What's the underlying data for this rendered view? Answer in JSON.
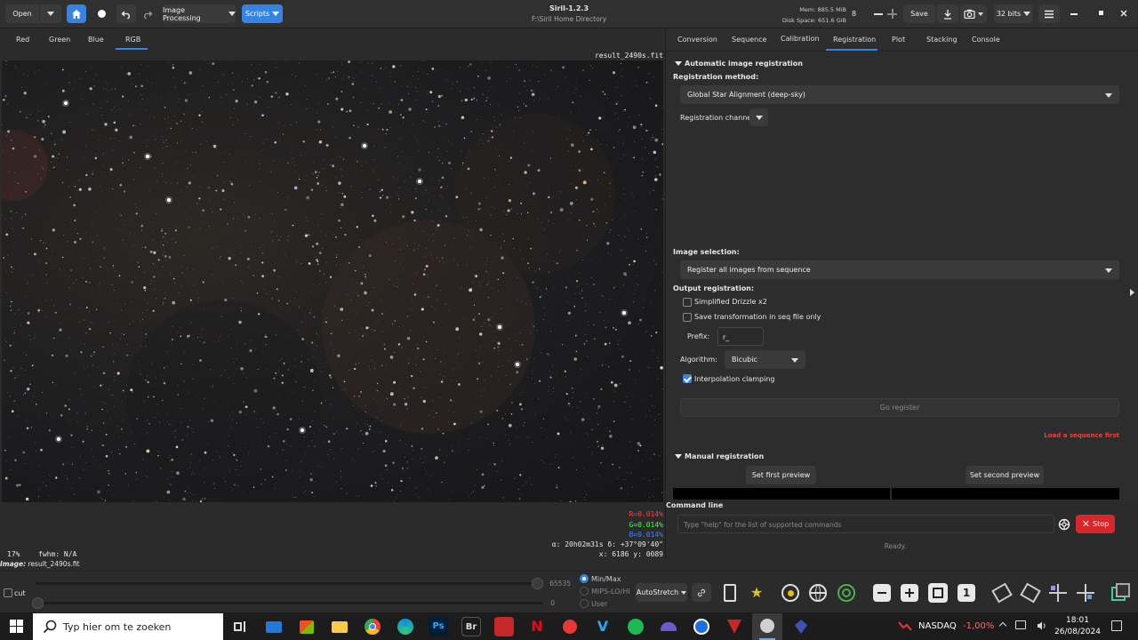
{
  "header": {
    "open_label": "Open",
    "image_processing_label": "Image Processing",
    "scripts_label": "Scripts",
    "app_title": "Siril-1.2.3",
    "app_subtitle": "F:\\Siril Home Directory",
    "mem": "Mem: 885.5 MiB",
    "disk": "Disk Space: 651.6 GiB",
    "threads": "8",
    "save_label": "Save",
    "bits_label": "32 bits"
  },
  "channels": [
    "Red",
    "Green",
    "Blue",
    "RGB"
  ],
  "viewer": {
    "filename": "result_2490s.fit",
    "r_value": "R=0.014%",
    "g_value": "G=0.014%",
    "b_value": "B=0.014%",
    "zoom": "17%",
    "fwhm": "fwhm: N/A",
    "coords": "α: 20h02m31s δ: +37°09'40\"",
    "xy": "x: 6186 y: 0089",
    "image_label": "Image:",
    "image_name": "result_2490s.fit"
  },
  "tabs": [
    "Conversion",
    "Sequence",
    "Calibration",
    "Registration",
    "Plot",
    "Stacking",
    "Console"
  ],
  "registration": {
    "section_title": "Automatic image registration",
    "method_label": "Registration method:",
    "method_value": "Global Star Alignment (deep-sky)",
    "channel_label": "Registration channel:",
    "selection_label": "Image selection:",
    "selection_value": "Register all images from sequence",
    "output_label": "Output registration:",
    "drizzle_label": "Simplified Drizzle x2",
    "save_transform_label": "Save transformation in seq file only",
    "prefix_label": "Prefix:",
    "prefix_value": "r_",
    "algorithm_label": "Algorithm:",
    "algorithm_value": "Bicubic",
    "clamping_label": "Interpolation clamping",
    "go_label": "Go register",
    "warning": "Load a sequence first",
    "manual_title": "Manual registration",
    "first_preview_label": "Set first preview",
    "second_preview_label": "Set second preview"
  },
  "command": {
    "title": "Command line",
    "placeholder": "Type \"help\" for the list of supported commands",
    "stop_label": "Stop",
    "status": "Ready."
  },
  "bottom": {
    "cut_label": "cut",
    "max_value": "65535",
    "min_value": "0",
    "minmax_label": "Min/Max",
    "mips_label": "MIPS-LO/HI",
    "user_label": "User",
    "autostretch_label": "AutoStretch"
  },
  "taskbar": {
    "search_placeholder": "Typ hier om te zoeken",
    "ticker": "NASDAQ",
    "ticker_change": "-1,00%",
    "time": "18:01",
    "date": "26/08/2024"
  },
  "colors": {
    "accent": "#3584e4",
    "warning": "#ff3b30",
    "stop": "#d9262a",
    "r": "#ff4040",
    "g": "#40ff40",
    "b": "#4080ff"
  }
}
